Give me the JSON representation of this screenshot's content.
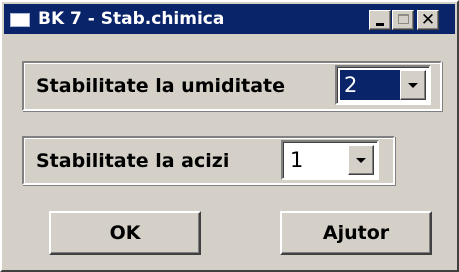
{
  "window": {
    "title": "BK 7 - Stab.chimica",
    "controls": {
      "minimize_icon": "minimize-icon",
      "maximize_icon": "maximize-icon",
      "close_glyph": "✕"
    }
  },
  "groups": [
    {
      "label": "Stabilitate la umiditate",
      "selected_value": "2",
      "focused": true
    },
    {
      "label": "Stabilitate la acizi",
      "selected_value": "1",
      "focused": false
    }
  ],
  "buttons": {
    "ok_label": "OK",
    "help_label": "Ajutor"
  },
  "colors": {
    "titlebar": "#0a246a",
    "face": "#d4d0c8",
    "selection": "#0a246a"
  }
}
